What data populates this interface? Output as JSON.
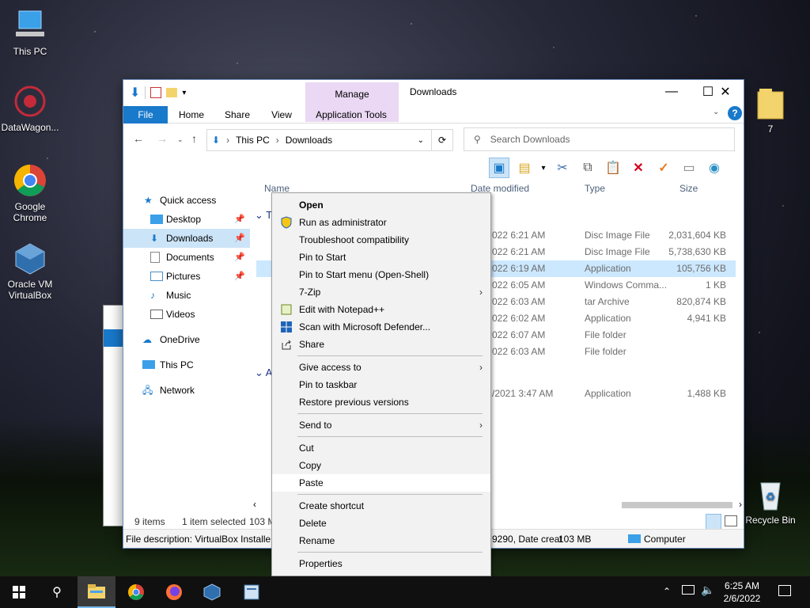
{
  "desktop": {
    "icons": [
      {
        "label": "This PC",
        "icon": "this-pc-icon"
      },
      {
        "label": "DataWagon...",
        "icon": "datawagon-icon"
      },
      {
        "label": "Google Chrome",
        "icon": "chrome-icon"
      },
      {
        "label": "Oracle VM VirtualBox",
        "icon": "virtualbox-icon"
      },
      {
        "label": "7",
        "icon": "folder-icon"
      },
      {
        "label": "Recycle Bin",
        "icon": "recycle-bin-icon"
      }
    ]
  },
  "explorer": {
    "manage_tab": "Manage",
    "title": "Downloads",
    "ribbon_tabs": [
      "File",
      "Home",
      "Share",
      "View",
      "Application Tools"
    ],
    "breadcrumb": [
      "This PC",
      "Downloads"
    ],
    "search_placeholder": "Search Downloads",
    "nav": {
      "quick_access": "Quick access",
      "items": [
        {
          "label": "Desktop",
          "pinned": true
        },
        {
          "label": "Downloads",
          "pinned": true,
          "selected": true
        },
        {
          "label": "Documents",
          "pinned": true
        },
        {
          "label": "Pictures",
          "pinned": true
        },
        {
          "label": "Music",
          "pinned": false
        },
        {
          "label": "Videos",
          "pinned": false
        }
      ],
      "onedrive": "OneDrive",
      "this_pc": "This PC",
      "network": "Network"
    },
    "columns": {
      "name": "Name",
      "date": "Date modified",
      "type": "Type",
      "size": "Size"
    },
    "group_label_1": "T",
    "group_label_2": "A",
    "files": [
      {
        "date": "022 6:21 AM",
        "type": "Disc Image File",
        "size": "2,031,604 KB"
      },
      {
        "date": "022 6:21 AM",
        "type": "Disc Image File",
        "size": "5,738,630 KB"
      },
      {
        "date": "022 6:19 AM",
        "type": "Application",
        "size": "105,756 KB"
      },
      {
        "date": "022 6:05 AM",
        "type": "Windows Comma...",
        "size": "1 KB"
      },
      {
        "date": "022 6:03 AM",
        "type": "tar Archive",
        "size": "820,874 KB"
      },
      {
        "date": "022 6:02 AM",
        "type": "Application",
        "size": "4,941 KB"
      },
      {
        "date": "022 6:07 AM",
        "type": "File folder",
        "size": ""
      },
      {
        "date": "022 6:03 AM",
        "type": "File folder",
        "size": ""
      },
      {
        "date": "/2021 3:47 AM",
        "type": "Application",
        "size": "1,488 KB"
      }
    ],
    "status": {
      "items": "9 items",
      "selected": "1 item selected",
      "size": "103 M"
    },
    "description": {
      "left": "File description: VirtualBox Installer,",
      "mid": "9290, Date creat",
      "size": "103 MB",
      "location": "Computer"
    }
  },
  "context_menu": [
    {
      "label": "Open",
      "bold": true
    },
    {
      "label": "Run as administrator",
      "icon": "shield-icon"
    },
    {
      "label": "Troubleshoot compatibility"
    },
    {
      "label": "Pin to Start"
    },
    {
      "label": "Pin to Start menu (Open-Shell)"
    },
    {
      "label": "7-Zip",
      "submenu": true
    },
    {
      "label": "Edit with Notepad++",
      "icon": "notepadpp-icon"
    },
    {
      "label": "Scan with Microsoft Defender...",
      "icon": "defender-icon"
    },
    {
      "label": "Share",
      "icon": "share-icon"
    },
    {
      "sep": true
    },
    {
      "label": "Give access to",
      "submenu": true
    },
    {
      "label": "Pin to taskbar"
    },
    {
      "label": "Restore previous versions"
    },
    {
      "sep": true
    },
    {
      "label": "Send to",
      "submenu": true
    },
    {
      "sep": true
    },
    {
      "label": "Cut"
    },
    {
      "label": "Copy"
    },
    {
      "label": "Paste",
      "highlighted": true
    },
    {
      "sep": true
    },
    {
      "label": "Create shortcut"
    },
    {
      "label": "Delete"
    },
    {
      "label": "Rename"
    },
    {
      "sep": true
    },
    {
      "label": "Properties"
    }
  ],
  "taskbar": {
    "time": "6:25 AM",
    "date": "2/6/2022"
  },
  "colors": {
    "accent": "#1979ca",
    "selection": "#cce8ff",
    "taskbar": "#101010"
  }
}
